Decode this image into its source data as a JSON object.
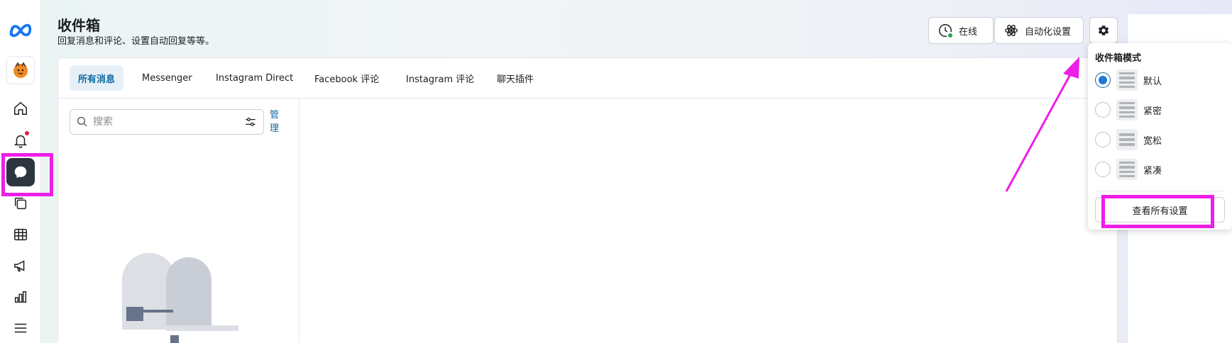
{
  "header": {
    "title": "收件箱",
    "subtitle": "回复消息和评论、设置自动回复等等。",
    "status_label": "在线",
    "automation_label": "自动化设置"
  },
  "tabs": [
    {
      "label": "所有消息",
      "active": true
    },
    {
      "label": "Messenger",
      "active": false
    },
    {
      "label": "Instagram Direct",
      "active": false
    },
    {
      "label": "Facebook 评论",
      "active": false
    },
    {
      "label": "Instagram 评论",
      "active": false
    },
    {
      "label": "聊天插件",
      "active": false
    }
  ],
  "search": {
    "placeholder": "搜索",
    "value": "",
    "manage_label": "管理"
  },
  "sidebar": {
    "icons": [
      "meta-logo-icon",
      "avatar",
      "home-icon",
      "bell-icon",
      "chat-bubble-icon",
      "layers-icon",
      "table-icon",
      "megaphone-icon",
      "bar-chart-icon",
      "menu-icon"
    ],
    "active": "chat-bubble-icon"
  },
  "popover": {
    "title": "收件箱模式",
    "modes": [
      {
        "label": "默认",
        "selected": true
      },
      {
        "label": "紧密",
        "selected": false
      },
      {
        "label": "宽松",
        "selected": false
      },
      {
        "label": "紧凑",
        "selected": false
      }
    ],
    "view_all_label": "查看所有设置"
  },
  "colors": {
    "accent": "#0b6aa2",
    "online": "#31a24c",
    "highlight": "#ee1ee6",
    "active_rail": "#2d3640"
  }
}
